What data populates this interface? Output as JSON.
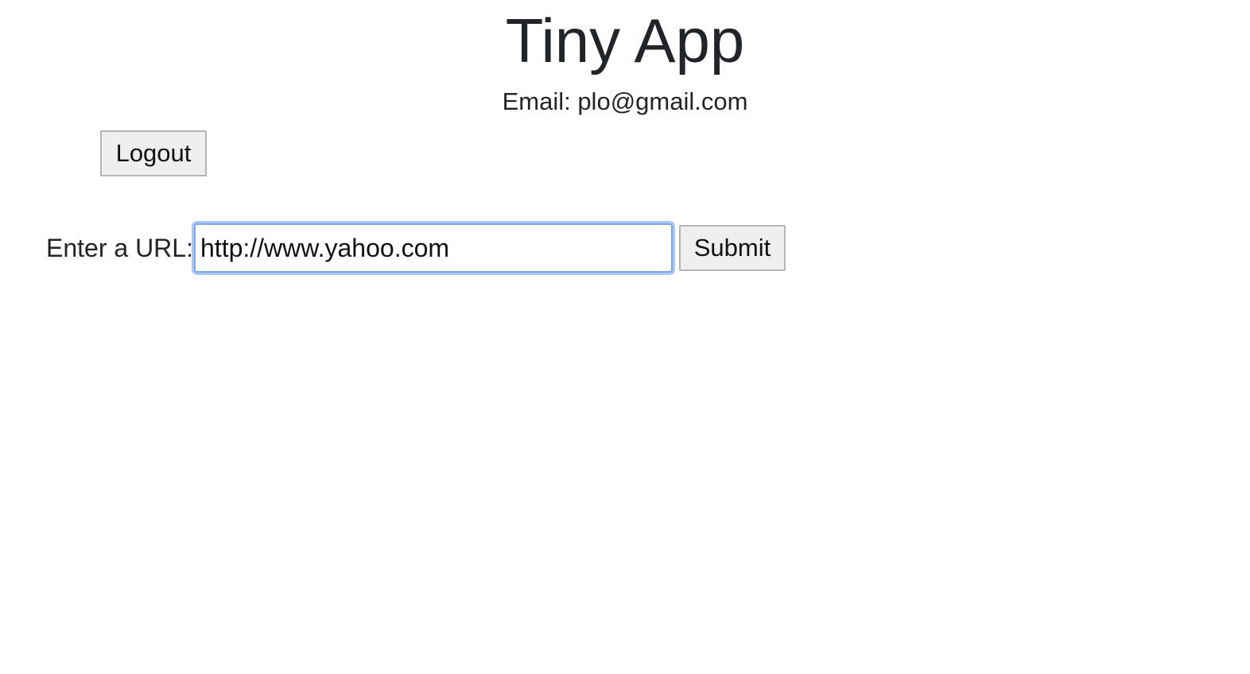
{
  "header": {
    "title": "Tiny App",
    "email_text": "Email: plo@gmail.com"
  },
  "auth": {
    "logout_label": "Logout"
  },
  "url_form": {
    "label": "Enter a URL:",
    "input_value": "http://www.yahoo.com",
    "submit_label": "Submit"
  },
  "colors": {
    "text": "#212529",
    "button_bg": "#efefef",
    "button_border": "#b5b5b5",
    "focus_ring": "#a9c8f5"
  }
}
